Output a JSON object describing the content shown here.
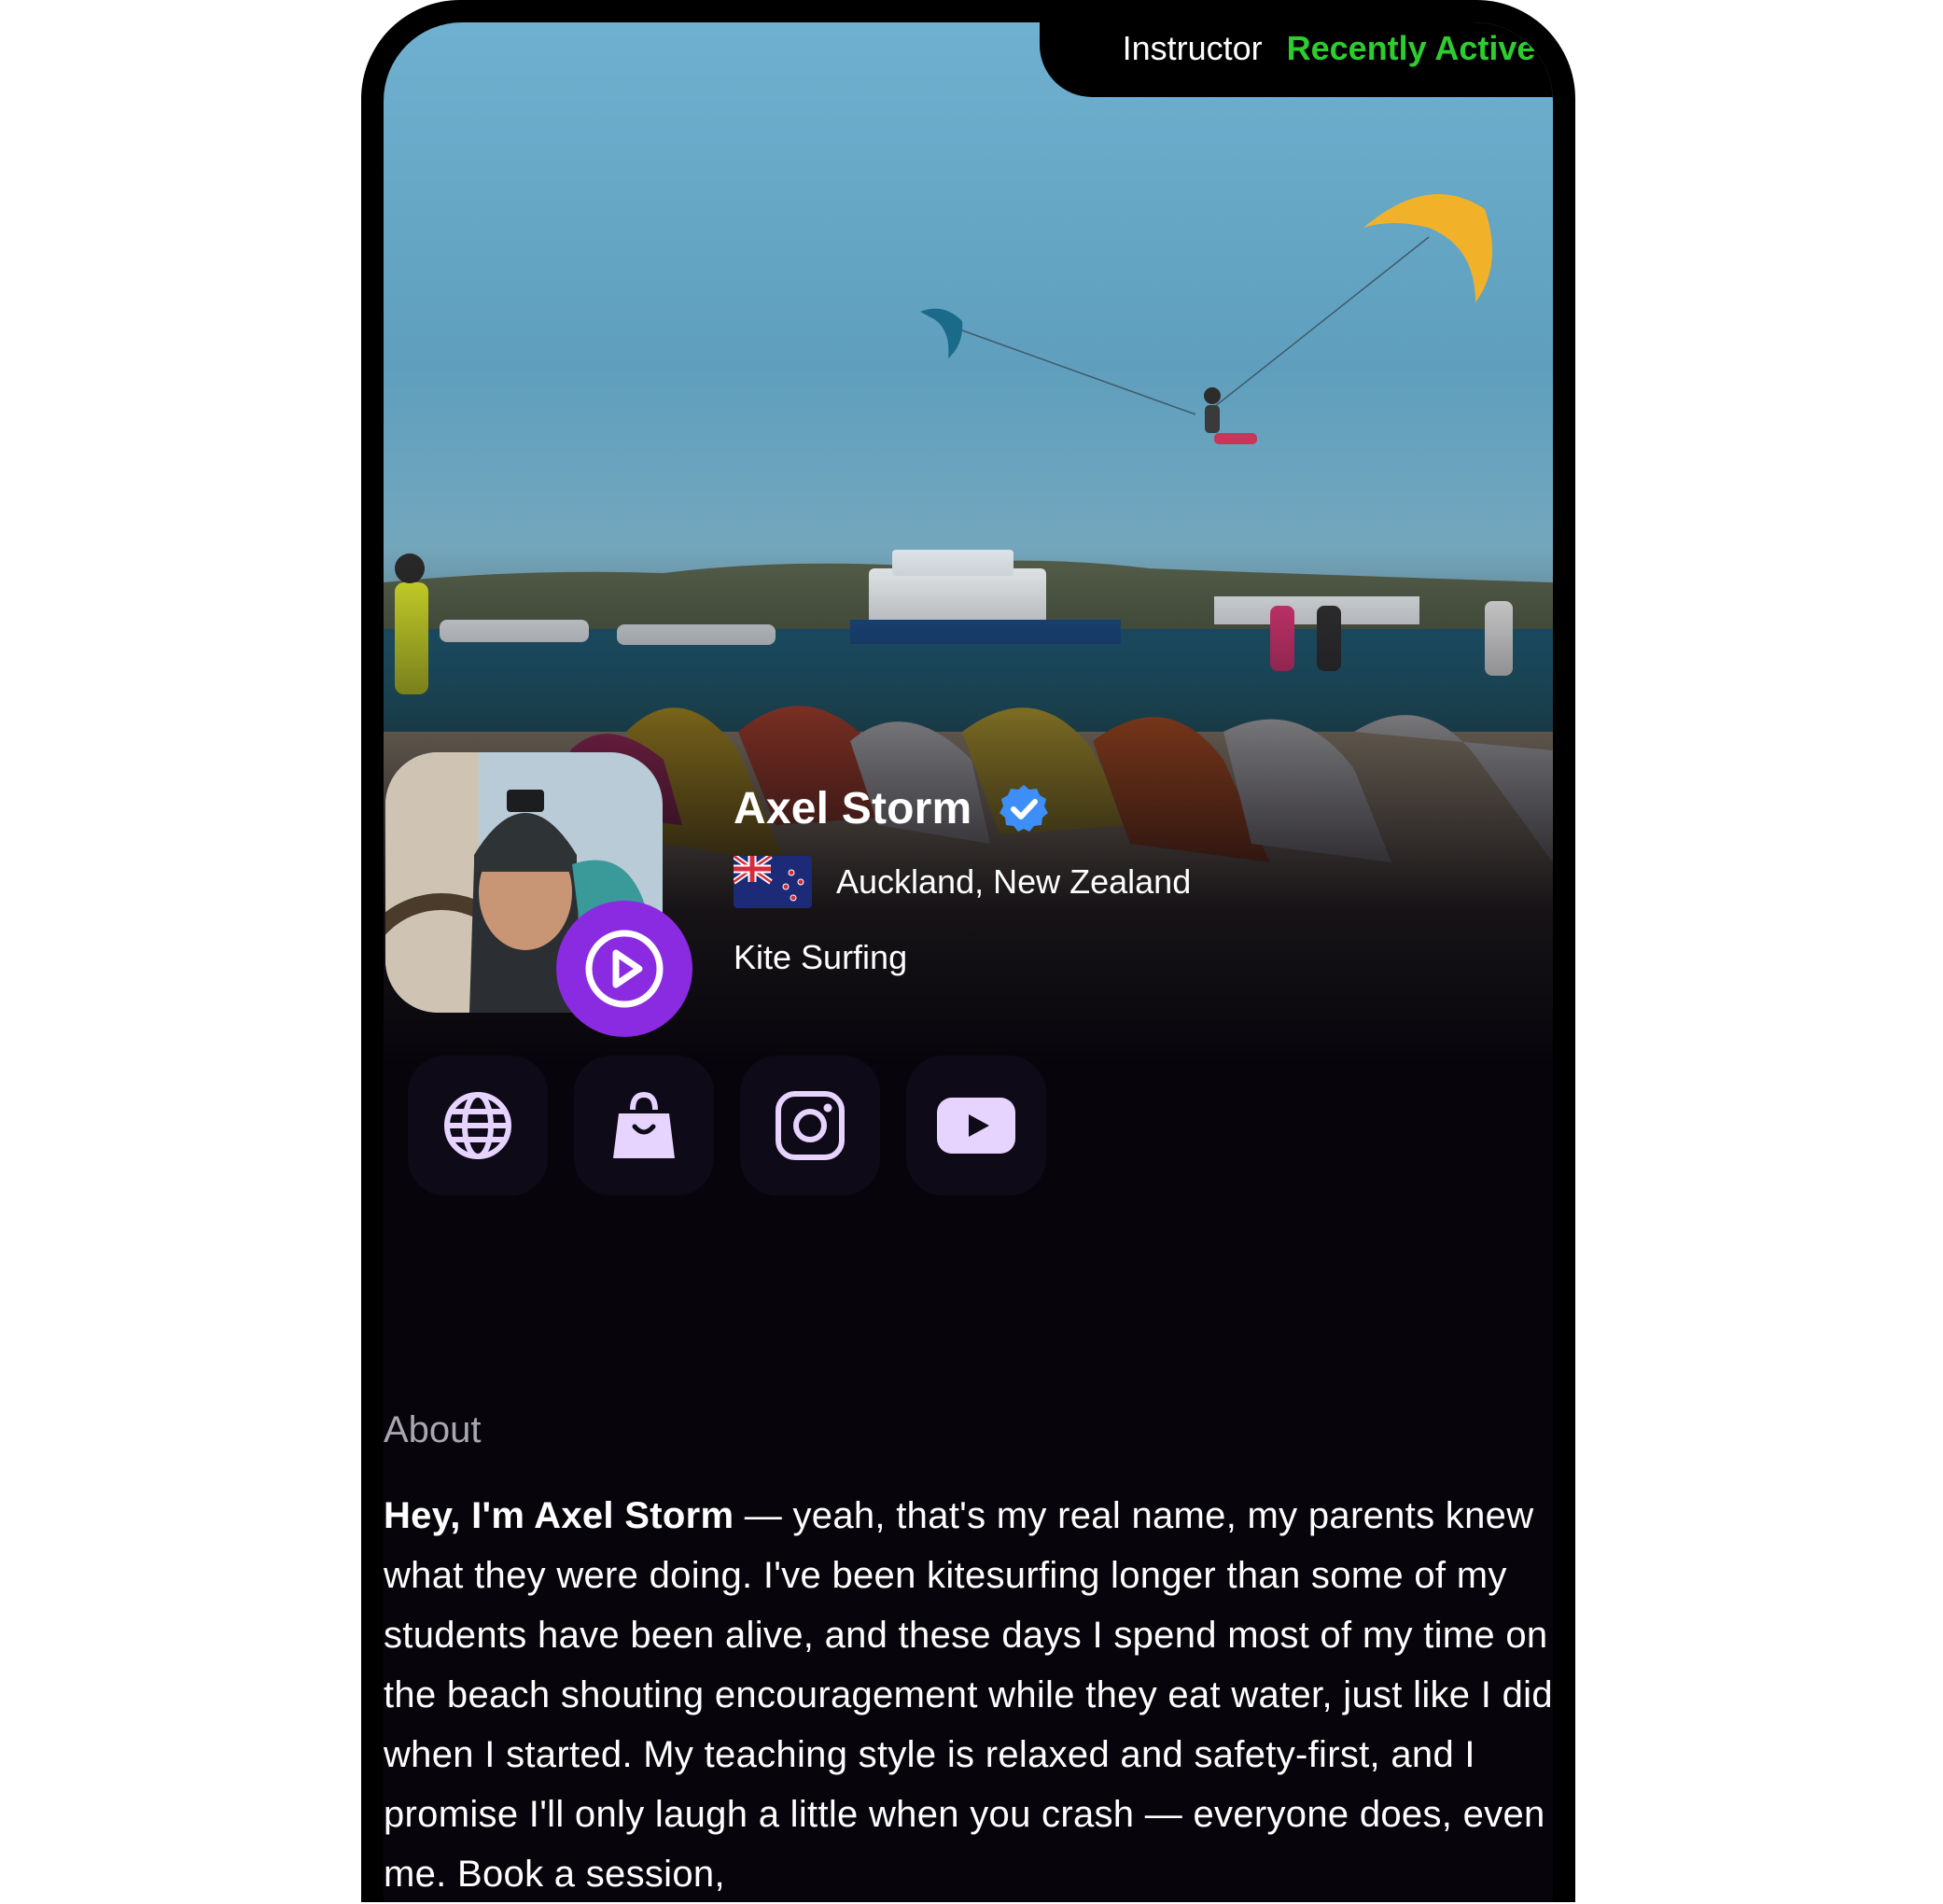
{
  "header": {
    "role": "Instructor",
    "status": "Recently Active",
    "status_color": "#2ecc2e"
  },
  "profile": {
    "name": "Axel Storm",
    "verified_icon": "verified-check-icon",
    "flag_icon": "new-zealand-flag-icon",
    "location": "Auckland, New Zealand",
    "sport": "Kite Surfing",
    "accent_color": "#8a2be2",
    "play_icon": "play-icon"
  },
  "socials": [
    {
      "icon": "globe-icon"
    },
    {
      "icon": "shopping-bag-icon"
    },
    {
      "icon": "instagram-icon"
    },
    {
      "icon": "youtube-icon"
    }
  ],
  "about": {
    "title": "About",
    "intro_bold": "Hey, I'm Axel Storm",
    "body": " — yeah, that's my real name, my parents knew what they were doing. I've been kitesurfing longer than some of my students have been alive, and these days I spend most of my time on the beach shouting encouragement while they eat water, just like I did when I started. My teaching style is relaxed and safety-first, and I promise I'll only laugh a little when you crash — everyone does, even me. Book a session,"
  }
}
